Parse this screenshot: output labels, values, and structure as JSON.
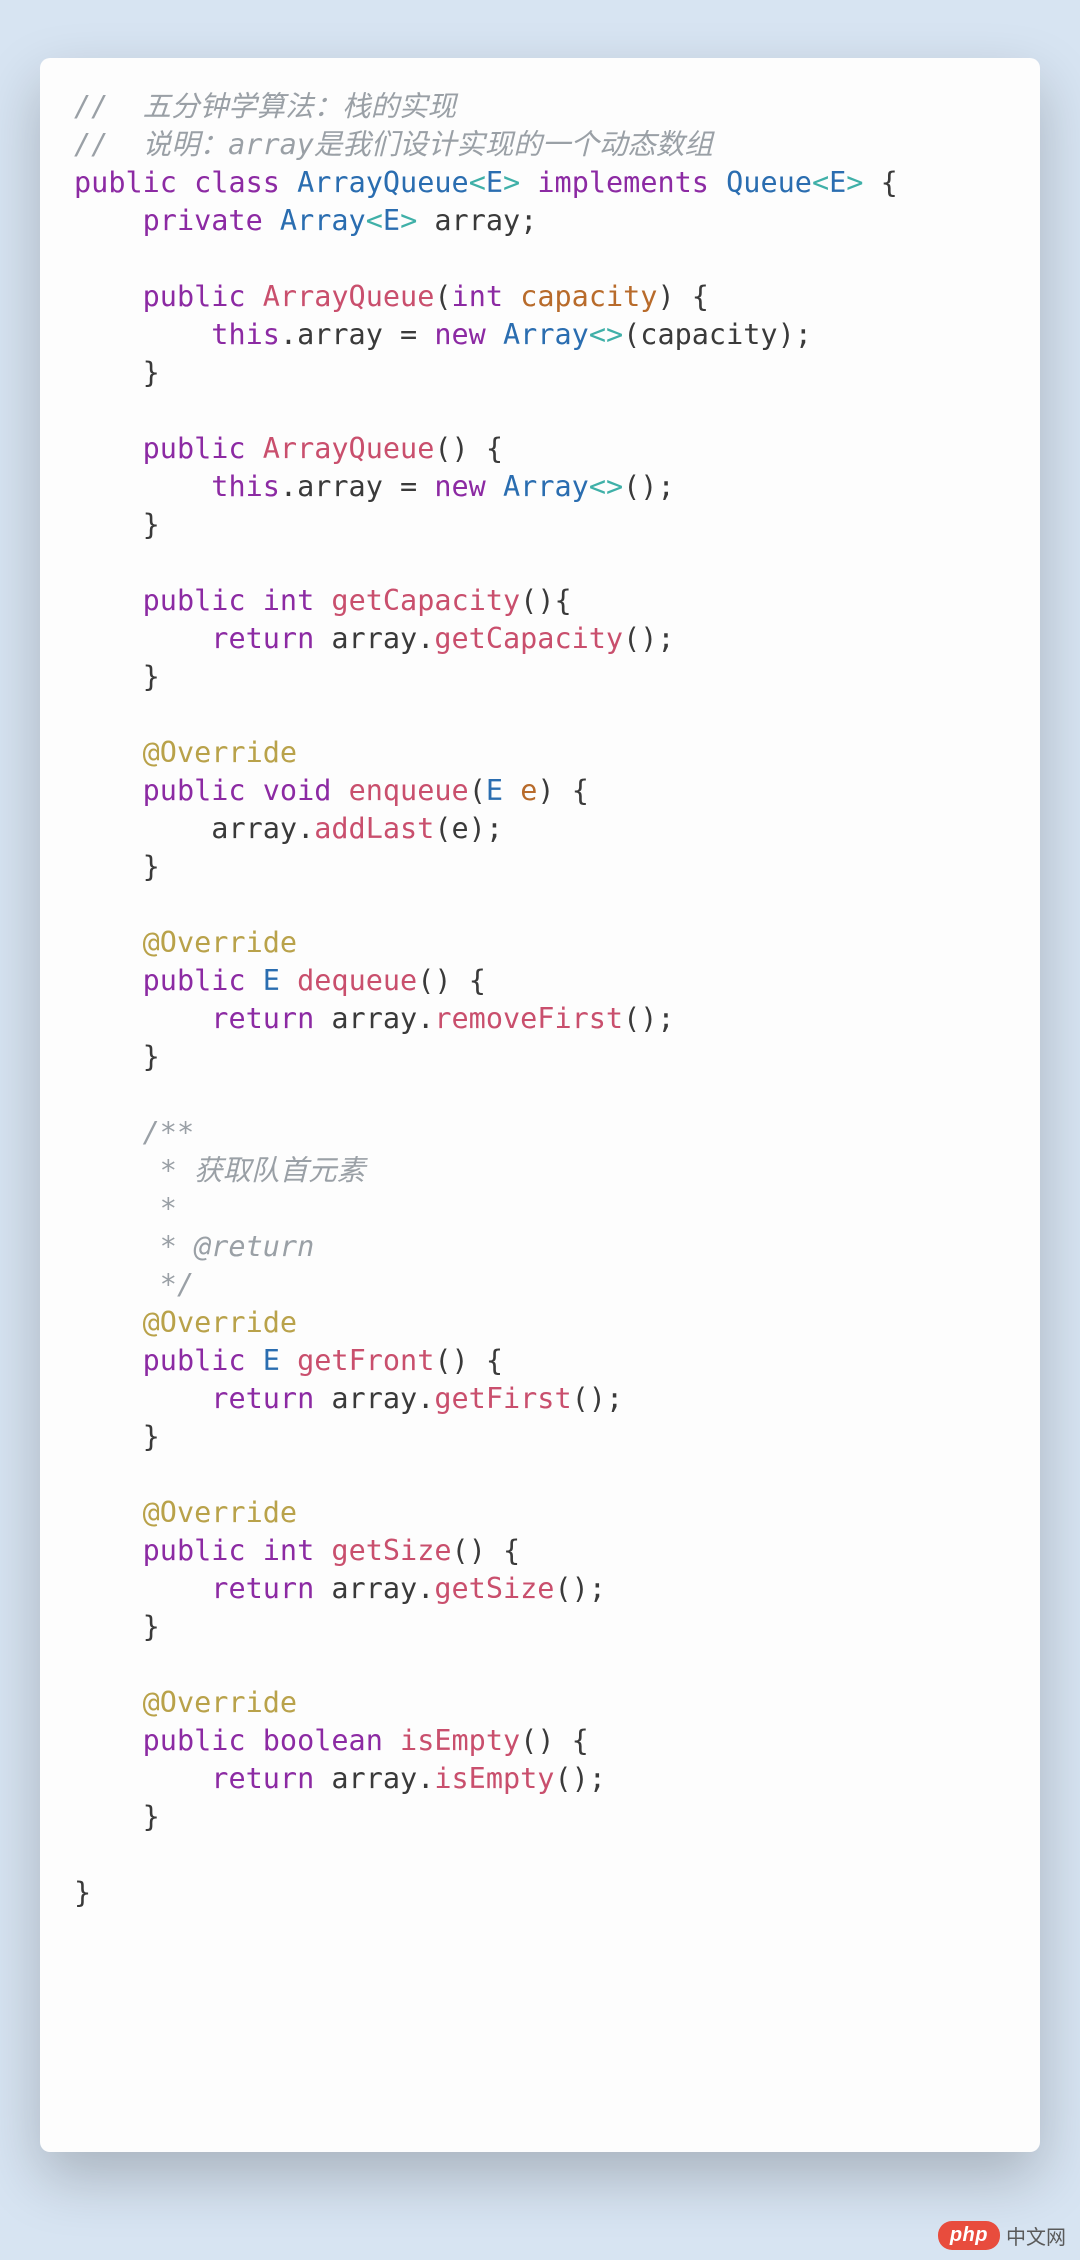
{
  "code": {
    "l1": "//  五分钟学算法：栈的实现",
    "l2": "//  说明：array是我们设计实现的一个动态数组",
    "l3a": "public",
    "l3b": "class",
    "l3c": "ArrayQueue",
    "l3d": "<",
    "l3e": "E",
    "l3f": ">",
    "l3g": "implements",
    "l3h": "Queue",
    "l3i": "<",
    "l3j": "E",
    "l3k": ">",
    "l3l": " {",
    "l4a": "private",
    "l4b": "Array",
    "l4c": "<",
    "l4d": "E",
    "l4e": ">",
    "l4f": " array;",
    "l6a": "public",
    "l6b": "ArrayQueue",
    "l6c": "(",
    "l6d": "int",
    "l6e": "capacity",
    "l6f": ") {",
    "l7a": "this",
    "l7b": ".array = ",
    "l7c": "new",
    "l7d": "Array",
    "l7e": "<>",
    "l7f": "(capacity);",
    "l8": "}",
    "l10a": "public",
    "l10b": "ArrayQueue",
    "l10c": "() {",
    "l11a": "this",
    "l11b": ".array = ",
    "l11c": "new",
    "l11d": "Array",
    "l11e": "<>",
    "l11f": "();",
    "l12": "}",
    "l14a": "public",
    "l14b": "int",
    "l14c": "getCapacity",
    "l14d": "(){",
    "l15a": "return",
    "l15b": " array.",
    "l15c": "getCapacity",
    "l15d": "();",
    "l16": "}",
    "l18": "@Override",
    "l19a": "public",
    "l19b": "void",
    "l19c": "enqueue",
    "l19d": "(",
    "l19e": "E",
    "l19f": "e",
    "l19g": ") {",
    "l20a": "array.",
    "l20b": "addLast",
    "l20c": "(e);",
    "l21": "}",
    "l23": "@Override",
    "l24a": "public",
    "l24b": "E",
    "l24c": "dequeue",
    "l24d": "() {",
    "l25a": "return",
    "l25b": " array.",
    "l25c": "removeFirst",
    "l25d": "();",
    "l26": "}",
    "l28": "/**",
    "l29": " * 获取队首元素",
    "l30": " *",
    "l31": " * @return",
    "l32": " */",
    "l33": "@Override",
    "l34a": "public",
    "l34b": "E",
    "l34c": "getFront",
    "l34d": "() {",
    "l35a": "return",
    "l35b": " array.",
    "l35c": "getFirst",
    "l35d": "();",
    "l36": "}",
    "l38": "@Override",
    "l39a": "public",
    "l39b": "int",
    "l39c": "getSize",
    "l39d": "() {",
    "l40a": "return",
    "l40b": " array.",
    "l40c": "getSize",
    "l40d": "();",
    "l41": "}",
    "l43": "@Override",
    "l44a": "public",
    "l44b": "boolean",
    "l44c": "isEmpty",
    "l44d": "() {",
    "l45a": "return",
    "l45b": " array.",
    "l45c": "isEmpty",
    "l45d": "();",
    "l46": "}",
    "l48": "}"
  },
  "watermark": {
    "pill": "php",
    "text": "中文网"
  }
}
